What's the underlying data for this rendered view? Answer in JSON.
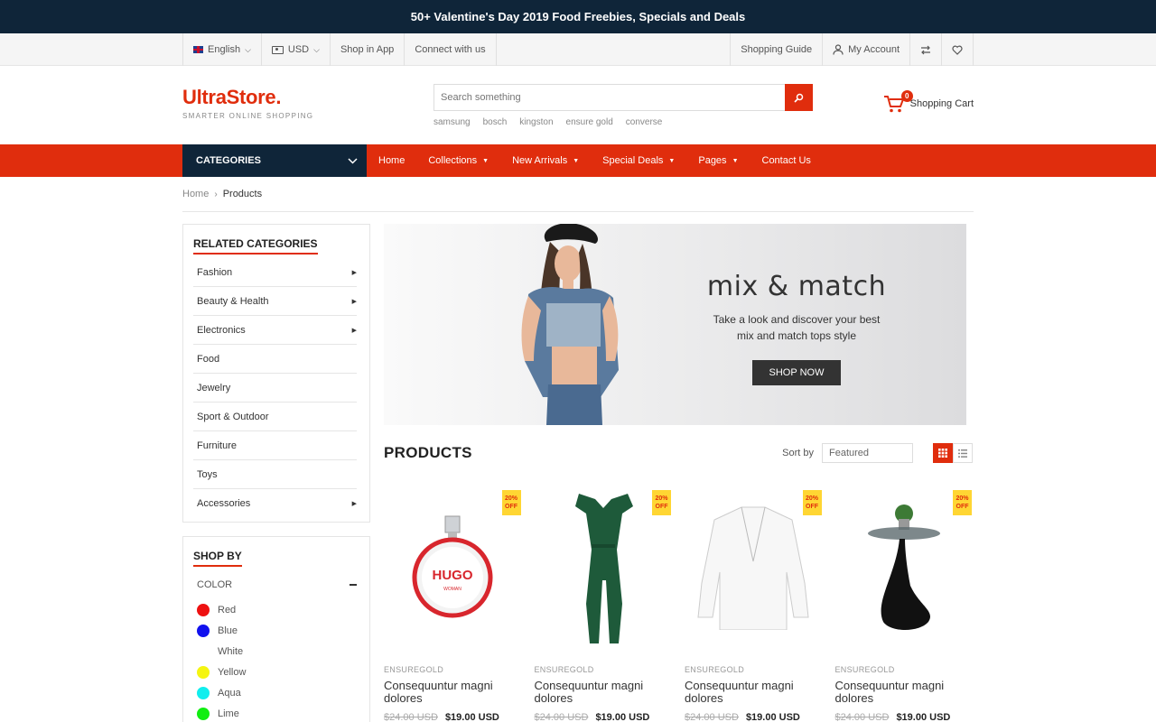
{
  "promo": {
    "text": "50+ Valentine's Day 2019 Food Freebies, Specials and Deals"
  },
  "topbar": {
    "language": "English",
    "currency": "USD",
    "shop_in_app": "Shop in App",
    "connect": "Connect with us",
    "shopping_guide": "Shopping Guide",
    "my_account": "My Account"
  },
  "header": {
    "logo": "UltraStore.",
    "tagline": "SMARTER ONLINE SHOPPING",
    "search_placeholder": "Search something",
    "search_tags": [
      "samsung",
      "bosch",
      "kingston",
      "ensure gold",
      "converse"
    ],
    "cart_label": "Shopping Cart",
    "cart_count": "0"
  },
  "nav": {
    "categories": "CATEGORIES",
    "items": [
      "Home",
      "Collections",
      "New Arrivals",
      "Special Deals",
      "Pages",
      "Contact Us"
    ]
  },
  "breadcrumb": {
    "home": "Home",
    "current": "Products"
  },
  "sidebar": {
    "related_title": "RELATED CATEGORIES",
    "categories": [
      "Fashion",
      "Beauty & Health",
      "Electronics",
      "Food",
      "Jewelry",
      "Sport & Outdoor",
      "Furniture",
      "Toys",
      "Accessories"
    ],
    "shopby_title": "SHOP BY",
    "color_label": "COLOR",
    "colors": [
      {
        "name": "Red",
        "hex": "#ee1111"
      },
      {
        "name": "Blue",
        "hex": "#1111ee"
      },
      {
        "name": "White",
        "hex": "#ffffff"
      },
      {
        "name": "Yellow",
        "hex": "#f5f511"
      },
      {
        "name": "Aqua",
        "hex": "#11eeee"
      },
      {
        "name": "Lime",
        "hex": "#11ee11"
      }
    ]
  },
  "banner": {
    "title": "mix & match",
    "subtitle_line1": "Take a look and discover your best",
    "subtitle_line2": "mix and match tops style",
    "cta": "SHOP NOW"
  },
  "products": {
    "title": "PRODUCTS",
    "sort_label": "Sort by",
    "sort_value": "Featured",
    "items": [
      {
        "badge": "20% OFF",
        "brand": "ENSUREGOLD",
        "name": "Consequuntur magni dolores",
        "old_price": "$24.00 USD",
        "price": "$19.00 USD",
        "icon": "perfume"
      },
      {
        "badge": "20% OFF",
        "brand": "ENSUREGOLD",
        "name": "Consequuntur magni dolores",
        "old_price": "$24.00 USD",
        "price": "$19.00 USD",
        "icon": "jumpsuit"
      },
      {
        "badge": "20% OFF",
        "brand": "ENSUREGOLD",
        "name": "Consequuntur magni dolores",
        "old_price": "$24.00 USD",
        "price": "$19.00 USD",
        "icon": "blazer"
      },
      {
        "badge": "20% OFF",
        "brand": "ENSUREGOLD",
        "name": "Consequuntur magni dolores",
        "old_price": "$24.00 USD",
        "price": "$19.00 USD",
        "icon": "side-table"
      }
    ]
  },
  "colors": {
    "accent": "#e02d0d",
    "dark": "#0f2539",
    "badge": "#ffd633"
  }
}
